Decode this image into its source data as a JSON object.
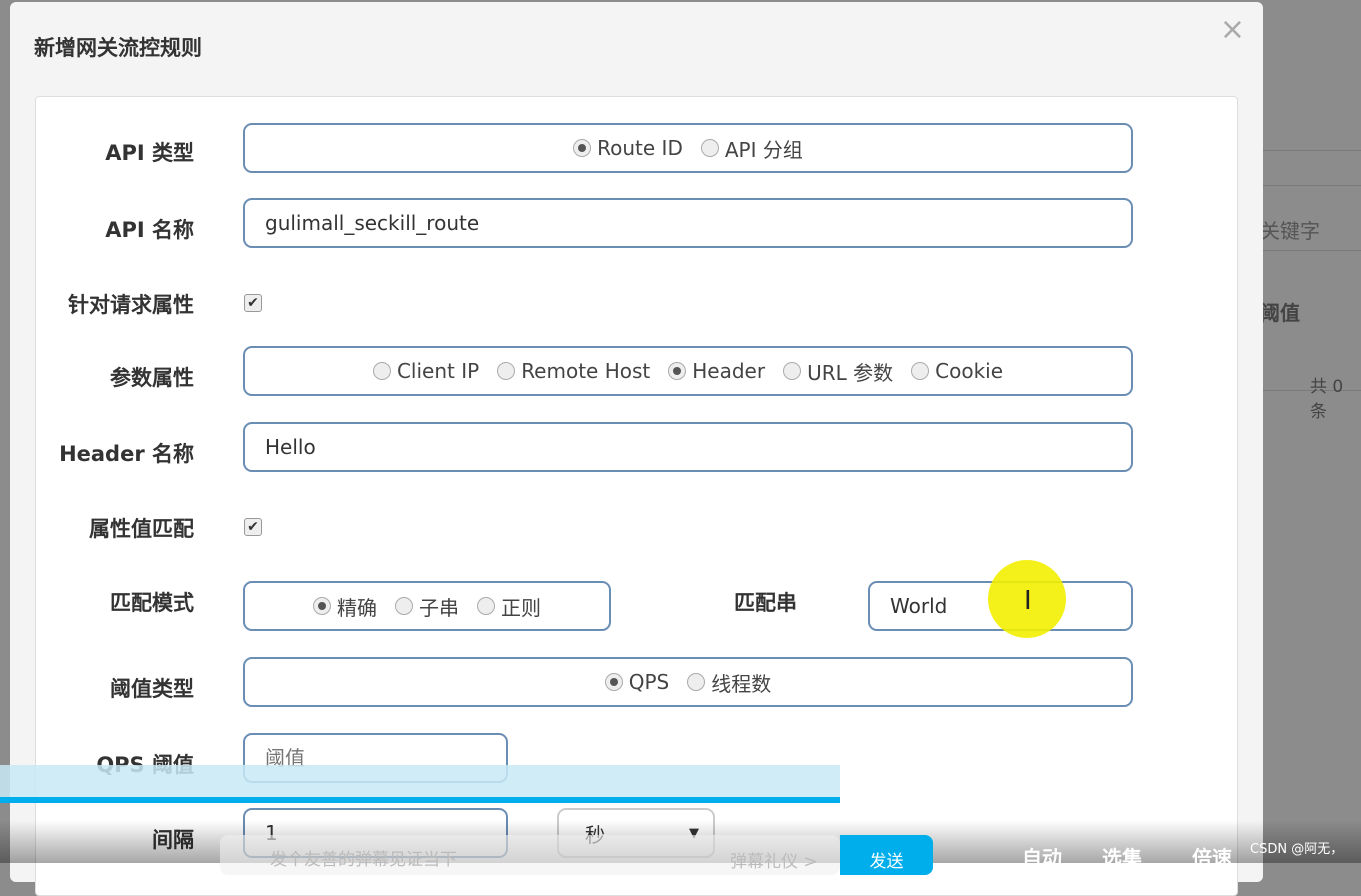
{
  "background": {
    "keyword_placeholder": "关键字",
    "col_threshold": "阈值",
    "total": "共 0 条"
  },
  "dialog": {
    "title": "新增网关流控规则",
    "close": "×"
  },
  "form": {
    "api_type": {
      "label": "API 类型",
      "options": [
        "Route ID",
        "API 分组"
      ],
      "selected": 0
    },
    "api_name": {
      "label": "API 名称",
      "value": "gulimall_seckill_route"
    },
    "request_attr": {
      "label": "针对请求属性",
      "checked": true
    },
    "param_attr": {
      "label": "参数属性",
      "options": [
        "Client IP",
        "Remote Host",
        "Header",
        "URL 参数",
        "Cookie"
      ],
      "selected": 2
    },
    "header_name": {
      "label": "Header 名称",
      "value": "Hello"
    },
    "value_match": {
      "label": "属性值匹配",
      "checked": true
    },
    "match_mode": {
      "label": "匹配模式",
      "options": [
        "精确",
        "子串",
        "正则"
      ],
      "selected": 0
    },
    "match_string": {
      "label": "匹配串",
      "value": "World"
    },
    "threshold_type": {
      "label": "阈值类型",
      "options": [
        "QPS",
        "线程数"
      ],
      "selected": 0
    },
    "qps_threshold": {
      "label": "QPS 阈值",
      "placeholder": "阈值"
    },
    "interval": {
      "label": "间隔",
      "value": "1",
      "unit": "秒"
    }
  },
  "player": {
    "danmaku_placeholder": "发个友善的弹幕见证当下",
    "etiquette": "弹幕礼仪 >",
    "send": "发送",
    "auto": "自动",
    "episodes": "选集",
    "speed": "倍速",
    "watermark": "CSDN @阿无，",
    "accent": "#00aeec"
  }
}
